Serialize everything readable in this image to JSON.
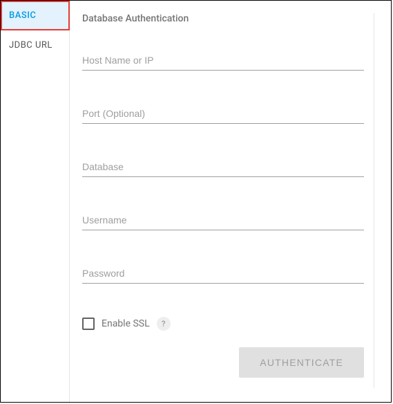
{
  "sidebar": {
    "tabs": [
      {
        "label": "BASIC",
        "active": true
      },
      {
        "label": "JDBC URL",
        "active": false
      }
    ]
  },
  "main": {
    "title": "Database Authentication",
    "fields": {
      "host_placeholder": "Host Name or IP",
      "port_placeholder": "Port (Optional)",
      "database_placeholder": "Database",
      "username_placeholder": "Username",
      "password_placeholder": "Password"
    },
    "ssl": {
      "label": "Enable SSL",
      "checked": false,
      "help": "?"
    },
    "button": {
      "label": "AUTHENTICATE"
    }
  }
}
